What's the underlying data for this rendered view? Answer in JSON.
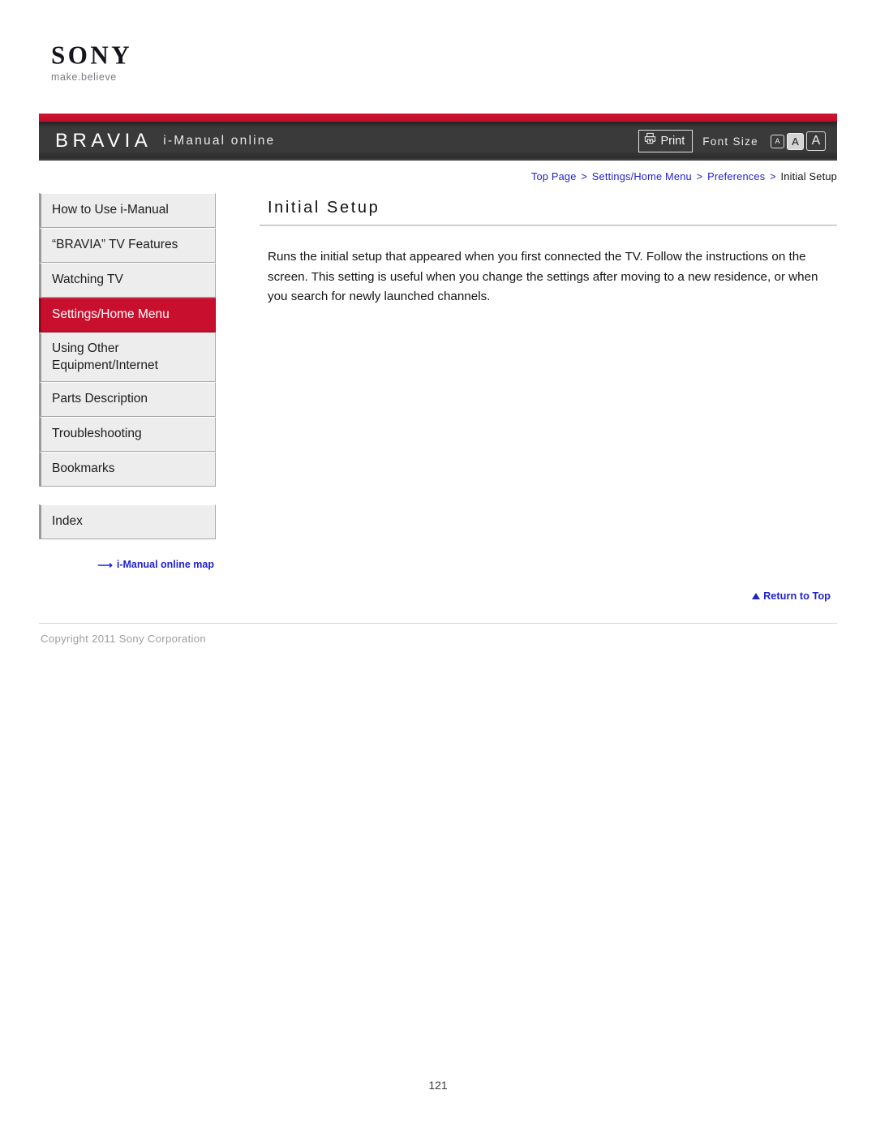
{
  "brand": {
    "wordmark": "SONY",
    "tagline": "make.believe"
  },
  "header": {
    "product": "BRAVIA",
    "subtitle": "i-Manual online",
    "print_label": "Print",
    "print_icon": "printer-icon",
    "font_size_label": "Font Size",
    "font_size_options": [
      {
        "label": "A",
        "size": "small",
        "selected": false
      },
      {
        "label": "A",
        "size": "medium",
        "selected": true
      },
      {
        "label": "A",
        "size": "large",
        "selected": false
      }
    ],
    "accent_color": "#c8102e",
    "bar_color": "#333333"
  },
  "breadcrumb": {
    "items": [
      {
        "label": "Top Page",
        "is_link": true
      },
      {
        "label": "Settings/Home Menu",
        "is_link": true
      },
      {
        "label": "Preferences",
        "is_link": true
      },
      {
        "label": "Initial Setup",
        "is_link": false
      }
    ],
    "separator": ">",
    "link_color": "#2222cc"
  },
  "sidebar": {
    "primary_items": [
      {
        "label": "How to Use i-Manual",
        "active": false
      },
      {
        "label": "“BRAVIA” TV Features",
        "active": false
      },
      {
        "label": "Watching TV",
        "active": false
      },
      {
        "label": "Settings/Home Menu",
        "active": true
      },
      {
        "label": "Using Other Equipment/Internet",
        "active": false
      },
      {
        "label": "Parts Description",
        "active": false
      },
      {
        "label": "Troubleshooting",
        "active": false
      },
      {
        "label": "Bookmarks",
        "active": false
      }
    ],
    "secondary_items": [
      {
        "label": "Index",
        "active": false
      }
    ],
    "map_link": {
      "label": "i-Manual online map",
      "icon": "arrow-right-icon"
    },
    "active_color": "#c8102e"
  },
  "main": {
    "title": "Initial Setup",
    "body": "Runs the initial setup that appeared when you first connected the TV. Follow the instructions on the screen. This setting is useful when you change the settings after moving to a new residence, or when you search for newly launched channels."
  },
  "footer": {
    "return_to_top": "Return to Top",
    "return_icon": "triangle-up-icon",
    "copyright": "Copyright 2011 Sony Corporation",
    "page_number": "121"
  }
}
